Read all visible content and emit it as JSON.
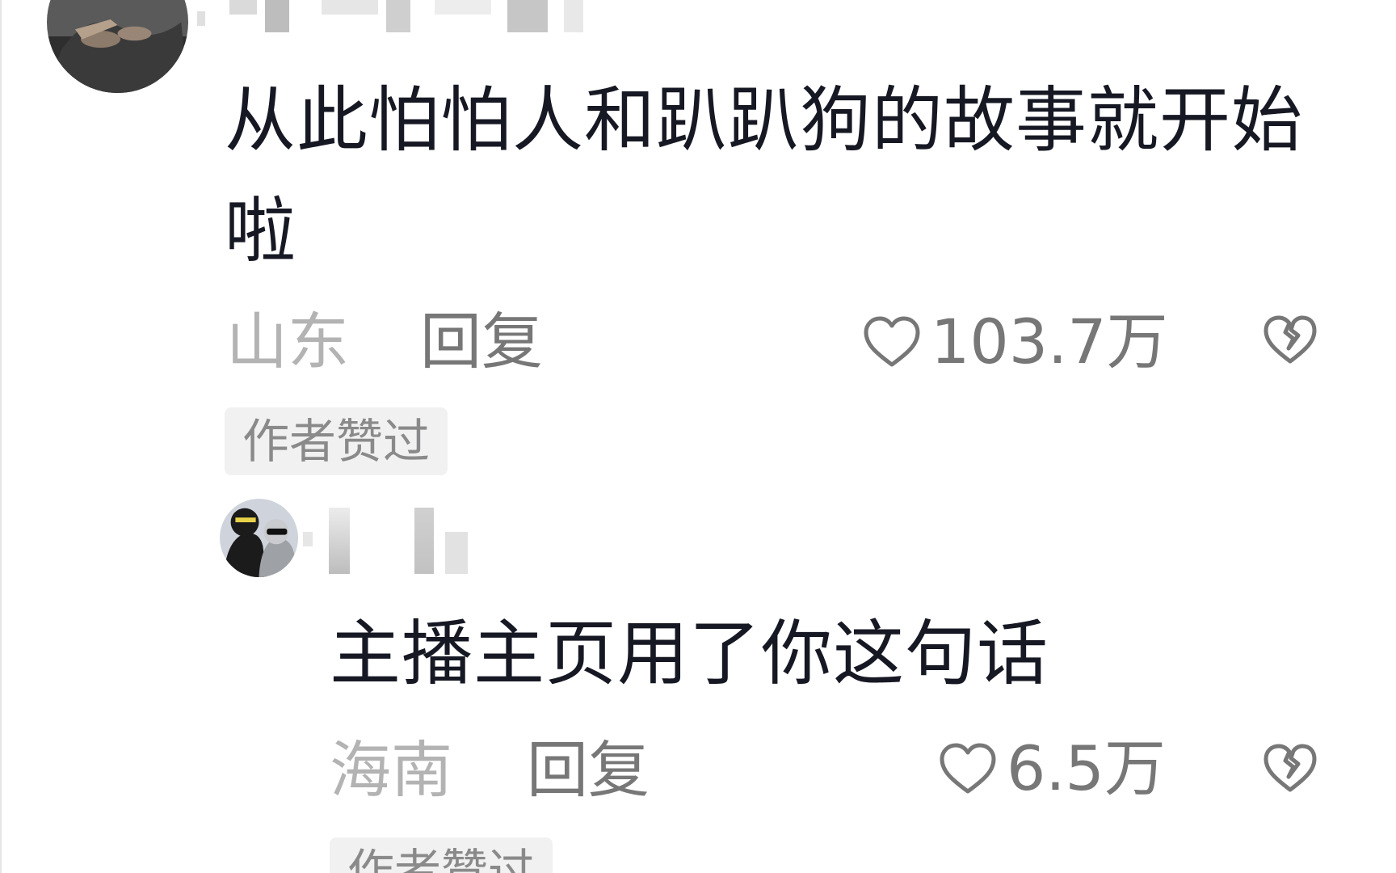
{
  "comments": [
    {
      "text": "从此怕怕人和趴趴狗的故事就开始啦",
      "location": "山东",
      "reply_label": "回复",
      "likes": "103.7万",
      "badge": "作者赞过"
    },
    {
      "text": "主播主页用了你这句话",
      "location": "海南",
      "reply_label": "回复",
      "likes": "6.5万",
      "badge": "作者赞过"
    }
  ],
  "icons": {
    "like": "heart-outline-icon",
    "dislike": "broken-heart-icon"
  },
  "colors": {
    "text": "#161823",
    "location": "#b3b3b3",
    "secondary": "#777777",
    "badge_bg": "#f1f1f2"
  }
}
